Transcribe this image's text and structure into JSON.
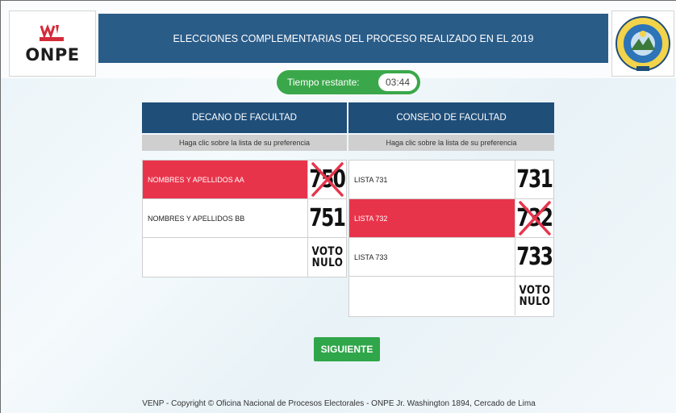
{
  "header": {
    "logo_text": "ONPE",
    "title": "ELECCIONES COMPLEMENTARIAS DEL PROCESO REALIZADO EN EL 2019"
  },
  "timer": {
    "label": "Tiempo restante:",
    "value": "03:44"
  },
  "decano": {
    "heading": "DECANO DE FACULTAD",
    "instruction": "Haga clic sobre la lista de su preferencia",
    "options": [
      {
        "label": "NOMBRES Y APELLIDOS AA",
        "number": "750",
        "selected": true
      },
      {
        "label": "NOMBRES Y APELLIDOS BB",
        "number": "751",
        "selected": false
      },
      {
        "label": "",
        "number": "VOTO NULO",
        "selected": false
      }
    ]
  },
  "consejo": {
    "heading": "CONSEJO DE FACULTAD",
    "instruction": "Haga clic sobre la lista de su preferencia",
    "options": [
      {
        "label": "LISTA 731",
        "number": "731",
        "selected": false
      },
      {
        "label": "LISTA 732",
        "number": "732",
        "selected": true
      },
      {
        "label": "LISTA 733",
        "number": "733",
        "selected": false
      },
      {
        "label": "",
        "number": "VOTO NULO",
        "selected": false
      }
    ]
  },
  "nulo": {
    "line1": "VOTO",
    "line2": "NULO"
  },
  "next_button": "SIGUIENTE",
  "footer": "VENP - Copyright © Oficina Nacional de Procesos Electorales - ONPE Jr. Washington 1894, Cercado de Lima",
  "colors": {
    "title_bar": "#2a5c88",
    "column_header": "#1f4e79",
    "selected": "#e8344b",
    "accent_green": "#3aa84a"
  }
}
